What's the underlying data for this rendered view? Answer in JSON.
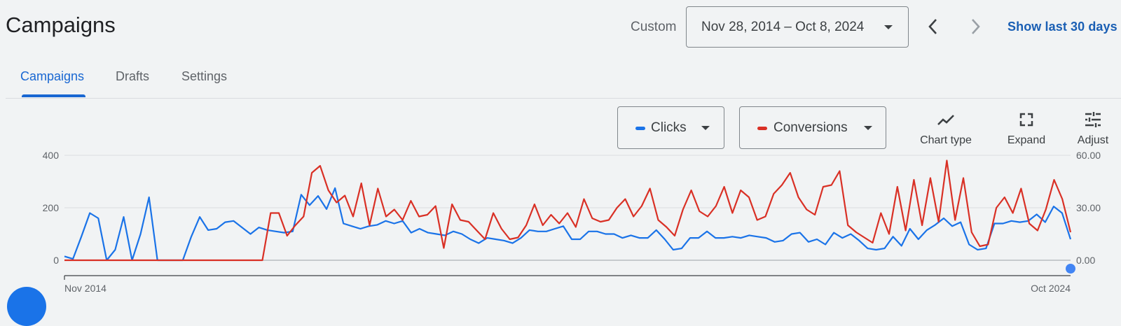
{
  "header": {
    "title": "Campaigns",
    "range_label": "Custom",
    "date_range": "Nov 28, 2014 – Oct 8, 2024",
    "show_last": "Show last 30 days"
  },
  "tabs": [
    {
      "label": "Campaigns",
      "active": true
    },
    {
      "label": "Drafts",
      "active": false
    },
    {
      "label": "Settings",
      "active": false
    }
  ],
  "metrics": [
    {
      "label": "Clicks",
      "color": "#1a73e8"
    },
    {
      "label": "Conversions",
      "color": "#d93025"
    }
  ],
  "tools": {
    "chart_type": "Chart type",
    "expand": "Expand",
    "adjust": "Adjust"
  },
  "chart_data": {
    "type": "line",
    "x_start_label": "Nov 2014",
    "x_end_label": "Oct 2024",
    "left_axis": {
      "ticks": [
        "400",
        "200",
        "0"
      ],
      "range": [
        0,
        400
      ]
    },
    "right_axis": {
      "ticks": [
        "60.00",
        "30.00",
        "0.00"
      ],
      "range": [
        0,
        60
      ]
    },
    "series": [
      {
        "name": "Clicks",
        "axis": "left",
        "color": "#1a73e8",
        "values": [
          15,
          5,
          90,
          180,
          160,
          0,
          40,
          165,
          0,
          100,
          240,
          0,
          0,
          0,
          0,
          90,
          165,
          115,
          120,
          145,
          150,
          125,
          100,
          125,
          115,
          110,
          105,
          110,
          250,
          210,
          245,
          195,
          275,
          140,
          130,
          120,
          130,
          135,
          150,
          140,
          150,
          105,
          120,
          105,
          100,
          95,
          110,
          100,
          80,
          65,
          85,
          80,
          75,
          65,
          85,
          115,
          110,
          110,
          120,
          130,
          80,
          80,
          110,
          110,
          100,
          100,
          85,
          95,
          85,
          85,
          115,
          80,
          40,
          45,
          85,
          85,
          110,
          85,
          85,
          90,
          85,
          95,
          90,
          85,
          70,
          75,
          100,
          105,
          70,
          80,
          60,
          105,
          85,
          100,
          75,
          45,
          40,
          45,
          90,
          55,
          120,
          80,
          115,
          135,
          160,
          130,
          145,
          60,
          40,
          45,
          140,
          140,
          150,
          145,
          150,
          175,
          145,
          205,
          180,
          80
        ]
      },
      {
        "name": "Conversions",
        "axis": "right",
        "color": "#d93025",
        "values": [
          0,
          0,
          0,
          0,
          0,
          0,
          0,
          0,
          0,
          0,
          0,
          0,
          0,
          0,
          0,
          0,
          0,
          0,
          0,
          0,
          0,
          0,
          0,
          0,
          0,
          27,
          27,
          14,
          20,
          25,
          50,
          54,
          40,
          33,
          37,
          25,
          44,
          20,
          41,
          25,
          29,
          23,
          34,
          25,
          26,
          31,
          7,
          32,
          23,
          22,
          17,
          12,
          27,
          18,
          12,
          13,
          20,
          32,
          20,
          26,
          21,
          27,
          19,
          35,
          24,
          22,
          23,
          30,
          35,
          25,
          31,
          41,
          23,
          19,
          14,
          29,
          40,
          28,
          25,
          31,
          42,
          27,
          40,
          36,
          23,
          25,
          38,
          43,
          50,
          36,
          29,
          26,
          42,
          43,
          51,
          20,
          16,
          13,
          10,
          27,
          15,
          42,
          17,
          46,
          20,
          47,
          22,
          57,
          23,
          47,
          16,
          8,
          9,
          30,
          36,
          27,
          41,
          21,
          17,
          29,
          46,
          35,
          16
        ]
      }
    ]
  }
}
